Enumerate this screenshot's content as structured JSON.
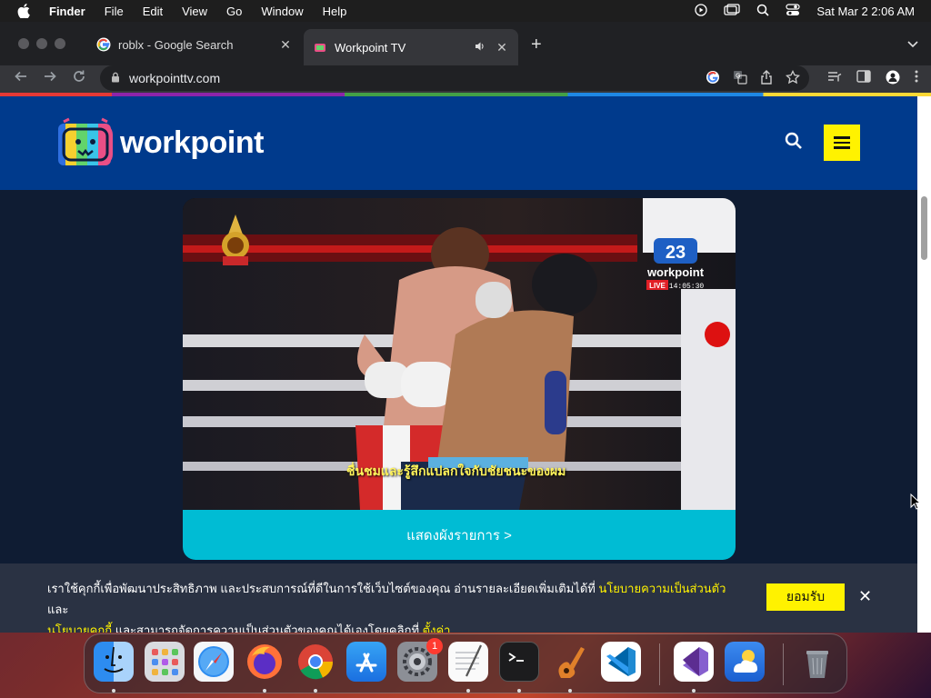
{
  "menubar": {
    "app": "Finder",
    "items": [
      "File",
      "Edit",
      "View",
      "Go",
      "Window",
      "Help"
    ],
    "clock": "Sat Mar 2  2:06 AM"
  },
  "browser": {
    "tabs": [
      {
        "title": "roblx - Google Search",
        "icon": "google-icon",
        "active": false
      },
      {
        "title": "Workpoint TV",
        "icon": "workpoint-favicon",
        "active": true,
        "audio": true
      }
    ],
    "url": "workpointtv.com",
    "page_load_colors": [
      "#e53935",
      "#8e24aa",
      "#43a047",
      "#1e88e5",
      "#fdd835"
    ]
  },
  "site": {
    "logo_text": "workpoint",
    "header_color": "#003a8c",
    "menu_button_color": "#fff200"
  },
  "video": {
    "subtitle": "ชื่นชมและรู้สึกแปลกใจกับชัยชนะของผม",
    "channel_number": "23",
    "channel_name": "workpoint",
    "live_label": "LIVE",
    "live_time": "14:05:30"
  },
  "cta": {
    "label": "แสดงผังรายการ >",
    "color": "#00bcd4"
  },
  "cookie": {
    "text_1": "เราใช้คุกกี้เพื่อพัฒนาประสิทธิภาพ และประสบการณ์ที่ดีในการใช้เว็บไซต์ของคุณ อ่านรายละเอียดเพิ่มเติมได้ที่ ",
    "link_1": "นโยบายความเป็นส่วนตัว",
    "text_2": " และ",
    "link_2": "นโยบายคุกกี้",
    "text_3": " และสามารถจัดการความเป็นส่วนตัวของคุณได้เองโดยคลิกที่ ",
    "link_3": "ตั้งค่า",
    "accept_label": "ยอมรับ"
  },
  "dock": {
    "apps": [
      "finder-icon",
      "launchpad-icon",
      "safari-icon",
      "firefox-icon",
      "chrome-icon",
      "app-store-icon",
      "system-settings-icon",
      "textedit-icon",
      "terminal-icon",
      "garageband-icon",
      "vscode-icon",
      "visual-studio-icon",
      "weather-icon",
      "trash-icon"
    ],
    "settings_badge": "1"
  }
}
